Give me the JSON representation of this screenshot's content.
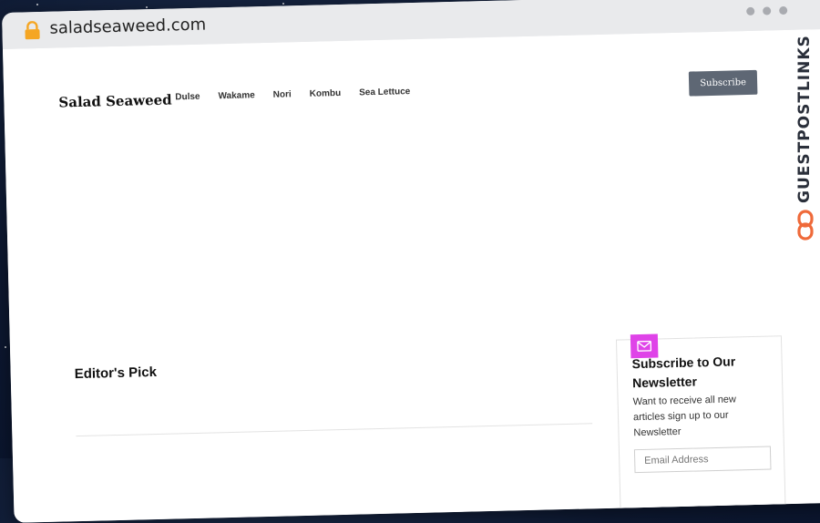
{
  "browser": {
    "url": "saladseaweed.com",
    "lock_icon": "lock-icon"
  },
  "site": {
    "name": "Salad Seaweed",
    "nav": [
      "Dulse",
      "Wakame",
      "Nori",
      "Kombu",
      "Sea Lettuce"
    ],
    "subscribe_label": "Subscribe"
  },
  "main": {
    "editors_pick": "Editor's Pick"
  },
  "newsletter": {
    "title": "Subscribe to Our Newsletter",
    "description": "Want to receive all new articles sign up to our Newsletter",
    "email_placeholder": "Email Address",
    "icon": "mail-icon"
  },
  "sidebar_brand": {
    "text": "GUESTPOSTLINKS",
    "icon": "link-icon",
    "accent": "#ef6a3a"
  }
}
